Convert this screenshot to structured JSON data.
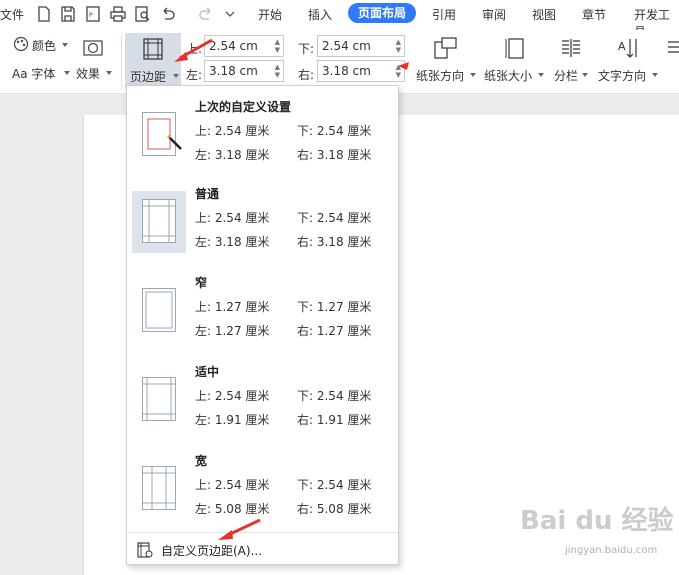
{
  "menubar": {
    "file": "文件",
    "tabs": [
      "开始",
      "插入",
      "页面布局",
      "引用",
      "审阅",
      "视图",
      "章节",
      "开发工具"
    ],
    "active_tab": "页面布局"
  },
  "ribbon": {
    "color_label": "颜色",
    "font_label": "Aa 字体",
    "effect_label": "效果",
    "margin_label": "页边距",
    "top_label": "上:",
    "bottom_label": "下:",
    "left_label": "左:",
    "right_label": "右:",
    "top_value": "2.54 cm",
    "bottom_value": "2.54 cm",
    "left_value": "3.18 cm",
    "right_value": "3.18 cm",
    "orientation_label": "纸张方向",
    "size_label": "纸张大小",
    "columns_label": "分栏",
    "text_dir_label": "文字方向"
  },
  "presets": [
    {
      "title": "上次的自定义设置",
      "top": "上: 2.54 厘米",
      "bottom": "下: 2.54 厘米",
      "left": "左: 3.18 厘米",
      "right": "右: 3.18 厘米"
    },
    {
      "title": "普通",
      "top": "上: 2.54 厘米",
      "bottom": "下: 2.54 厘米",
      "left": "左: 3.18 厘米",
      "right": "右: 3.18 厘米"
    },
    {
      "title": "窄",
      "top": "上: 1.27 厘米",
      "bottom": "下: 1.27 厘米",
      "left": "左: 1.27 厘米",
      "right": "右: 1.27 厘米"
    },
    {
      "title": "适中",
      "top": "上: 2.54 厘米",
      "bottom": "下: 2.54 厘米",
      "left": "左: 1.91 厘米",
      "right": "右: 1.91 厘米"
    },
    {
      "title": "宽",
      "top": "上: 2.54 厘米",
      "bottom": "下: 2.54 厘米",
      "left": "左: 5.08 厘米",
      "right": "右: 5.08 厘米"
    }
  ],
  "custom_margin_label": "自定义页边距(A)...",
  "watermark": "Bai du 经验",
  "watermark_url": "jingyan.baidu.com",
  "colors": {
    "accent": "#2f7bf5",
    "arrow": "#e8322a"
  }
}
